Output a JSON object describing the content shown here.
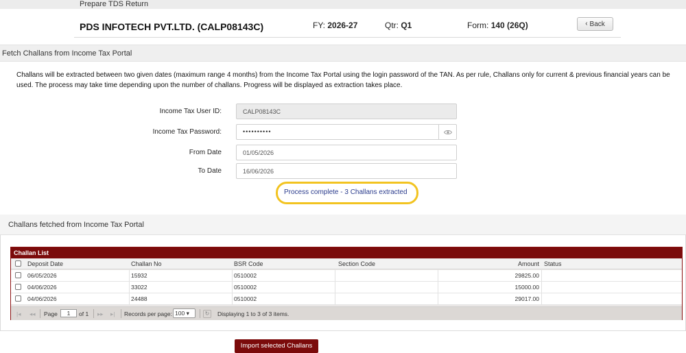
{
  "top_bar": {
    "title": "Prepare TDS Return"
  },
  "header": {
    "company": "PDS INFOTECH PVT.LTD. (CALP08143C)",
    "fy_label": "FY:",
    "fy_value": "2026-27",
    "qtr_label": "Qtr:",
    "qtr_value": "Q1",
    "form_label": "Form:",
    "form_value": "140 (26Q)",
    "back_label": "Back",
    "back_icon": "chevron-left-icon"
  },
  "fetch_section": {
    "title": "Fetch Challans from Income Tax Portal",
    "description": "Challans will be extracted between two given dates (maximum range 4 months) from the Income Tax Portal using the login password of the TAN. As per rule, Challans only for current & previous financial years can be used. The process may take time depending upon the number of challans. Progress will be displayed as extraction takes place.",
    "user_id_label": "Income Tax User ID:",
    "user_id_value": "CALP08143C",
    "password_label": "Income Tax Password:",
    "password_value": "••••••••••",
    "password_icon": "eye-icon",
    "from_date_label": "From Date",
    "from_date_value": "01/05/2026",
    "to_date_label": "To Date",
    "to_date_value": "16/06/2026",
    "status_text": "Process complete - 3 Challans extracted",
    "status_highlight_color": "#f2c320"
  },
  "fetched_section": {
    "title": "Challans fetched from Income Tax Portal",
    "grid": {
      "title": "Challan List",
      "header_color": "#7b0b0b",
      "columns": [
        "Deposit Date",
        "Challan No",
        "BSR Code",
        "Section Code",
        "Amount",
        "Status"
      ],
      "rows": [
        [
          "06/05/2026",
          "15932",
          "0510002",
          "",
          "29825.00",
          ""
        ],
        [
          "04/06/2026",
          "33022",
          "0510002",
          "",
          "15000.00",
          ""
        ],
        [
          "04/06/2026",
          "24488",
          "0510002",
          "",
          "29017.00",
          ""
        ]
      ],
      "pager": {
        "page_label": "Page",
        "page_value": "1",
        "of_label": "of 1",
        "records_label": "Records per page:",
        "records_value": "100",
        "display_text": "Displaying 1 to 3 of 3 items."
      }
    },
    "import_label": "Import selected Challans"
  }
}
